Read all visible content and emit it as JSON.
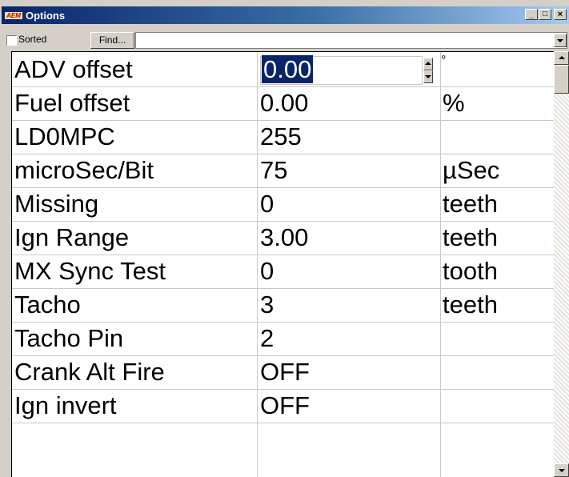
{
  "window": {
    "title": "Options",
    "logo_text": "AEM",
    "minimize_glyph": "_",
    "restore_glyph": "□",
    "close_glyph": "×"
  },
  "toolbar": {
    "sorted_label": "Sorted",
    "sorted_checked": false,
    "find_label": "Find...",
    "filter_value": ""
  },
  "options": [
    {
      "name": "ADV offset",
      "value": "0.00",
      "unit": "°"
    },
    {
      "name": "Fuel offset",
      "value": "0.00",
      "unit": "%"
    },
    {
      "name": "LD0MPC",
      "value": "255",
      "unit": ""
    },
    {
      "name": "microSec/Bit",
      "value": "75",
      "unit": "µSec"
    },
    {
      "name": "Missing",
      "value": "0",
      "unit": "teeth"
    },
    {
      "name": "Ign Range",
      "value": "3.00",
      "unit": "teeth"
    },
    {
      "name": "MX Sync Test",
      "value": "0",
      "unit": "tooth"
    },
    {
      "name": "Tacho",
      "value": "3",
      "unit": "teeth"
    },
    {
      "name": "Tacho Pin",
      "value": "2",
      "unit": ""
    },
    {
      "name": "Crank Alt Fire",
      "value": "OFF",
      "unit": ""
    },
    {
      "name": "Ign invert",
      "value": "OFF",
      "unit": ""
    }
  ],
  "selected_row": 0,
  "colors": {
    "title_start": "#0a246a",
    "title_end": "#a6caf0",
    "selection": "#0a246a",
    "face": "#d4d0c8"
  }
}
